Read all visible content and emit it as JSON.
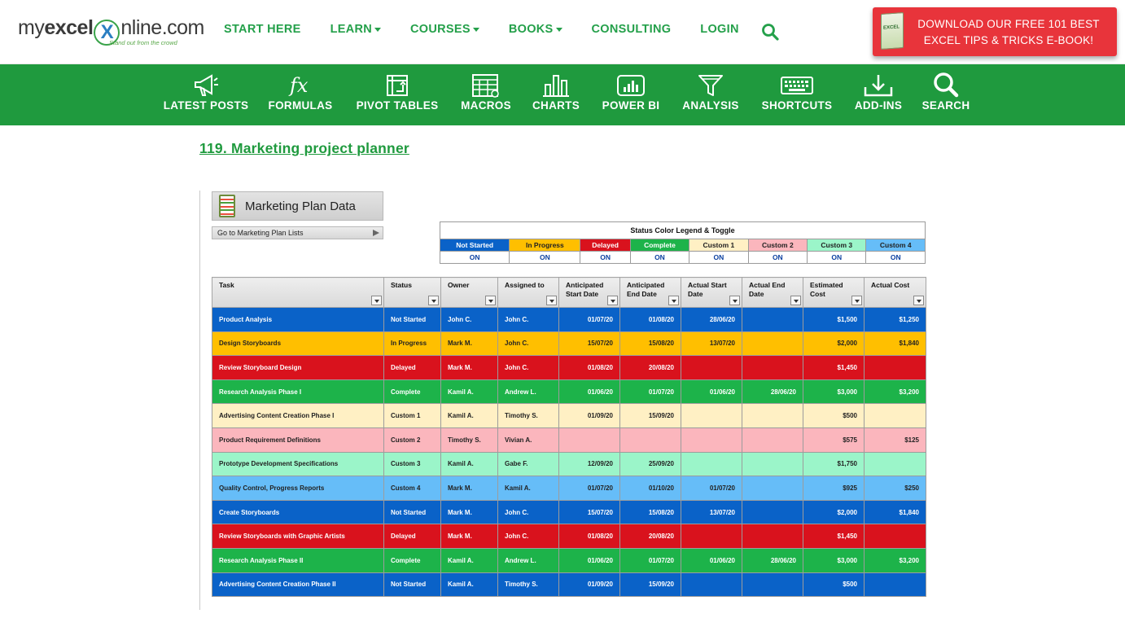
{
  "logo": {
    "text_my": "my",
    "text_excel": "excel",
    "text_x": "X",
    "text_rest": "nline.com",
    "tagline": "Stand out from the crowd"
  },
  "topnav": [
    {
      "label": "START HERE",
      "dropdown": false
    },
    {
      "label": "LEARN",
      "dropdown": true
    },
    {
      "label": "COURSES",
      "dropdown": true
    },
    {
      "label": "BOOKS",
      "dropdown": true
    },
    {
      "label": "CONSULTING",
      "dropdown": false
    },
    {
      "label": "LOGIN",
      "dropdown": false
    }
  ],
  "cta": {
    "line1": "DOWNLOAD OUR FREE 101 BEST",
    "line2": "EXCEL TIPS & TRICKS E-BOOK!",
    "book_label": "EXCEL"
  },
  "categories": [
    {
      "label": "LATEST POSTS",
      "icon": "megaphone-icon"
    },
    {
      "label": "FORMULAS",
      "icon": "function-icon"
    },
    {
      "label": "PIVOT TABLES",
      "icon": "pivot-table-icon"
    },
    {
      "label": "MACROS",
      "icon": "macro-sheet-icon"
    },
    {
      "label": "CHARTS",
      "icon": "bar-chart-icon"
    },
    {
      "label": "POWER BI",
      "icon": "power-bi-icon"
    },
    {
      "label": "ANALYSIS",
      "icon": "filter-funnel-icon"
    },
    {
      "label": "SHORTCUTS",
      "icon": "keyboard-icon"
    },
    {
      "label": "ADD-INS",
      "icon": "download-icon"
    },
    {
      "label": "SEARCH",
      "icon": "search-icon"
    }
  ],
  "article": {
    "heading": "119. Marketing project planner"
  },
  "sheet": {
    "title": "Marketing Plan Data",
    "goto": "Go to Marketing Plan Lists",
    "legend_title": "Status Color Legend & Toggle",
    "legend": [
      {
        "name": "Not Started",
        "toggle": "ON",
        "bg": "#0a62c8",
        "fg": "#ffffff"
      },
      {
        "name": "In Progress",
        "toggle": "ON",
        "bg": "#ffbf00",
        "fg": "#222222"
      },
      {
        "name": "Delayed",
        "toggle": "ON",
        "bg": "#d9121d",
        "fg": "#ffffff"
      },
      {
        "name": "Complete",
        "toggle": "ON",
        "bg": "#1db34a",
        "fg": "#ffffff"
      },
      {
        "name": "Custom 1",
        "toggle": "ON",
        "bg": "#fff0c4",
        "fg": "#222222"
      },
      {
        "name": "Custom 2",
        "toggle": "ON",
        "bg": "#fbb6bd",
        "fg": "#222222"
      },
      {
        "name": "Custom 3",
        "toggle": "ON",
        "bg": "#9bf5c9",
        "fg": "#222222"
      },
      {
        "name": "Custom 4",
        "toggle": "ON",
        "bg": "#66bdf8",
        "fg": "#222222"
      }
    ],
    "columns": [
      "Task",
      "Status",
      "Owner",
      "Assigned to",
      "Anticipated Start Date",
      "Anticipated End Date",
      "Actual Start Date",
      "Actual End Date",
      "Estimated Cost",
      "Actual Cost"
    ],
    "rows": [
      [
        "Product Analysis",
        "Not Started",
        "John C.",
        "John C.",
        "01/07/20",
        "01/08/20",
        "28/06/20",
        "",
        "$1,500",
        "$1,250"
      ],
      [
        "Design Storyboards",
        "In Progress",
        "Mark M.",
        "John C.",
        "15/07/20",
        "15/08/20",
        "13/07/20",
        "",
        "$2,000",
        "$1,840"
      ],
      [
        "Review Storyboard Design",
        "Delayed",
        "Mark M.",
        "John C.",
        "01/08/20",
        "20/08/20",
        "",
        "",
        "$1,450",
        ""
      ],
      [
        "Research Analysis Phase I",
        "Complete",
        "Kamil A.",
        "Andrew L.",
        "01/06/20",
        "01/07/20",
        "01/06/20",
        "28/06/20",
        "$3,000",
        "$3,200"
      ],
      [
        "Advertising Content Creation Phase I",
        "Custom 1",
        "Kamil A.",
        "Timothy S.",
        "01/09/20",
        "15/09/20",
        "",
        "",
        "$500",
        ""
      ],
      [
        "Product Requirement Definitions",
        "Custom 2",
        "Timothy S.",
        "Vivian A.",
        "",
        "",
        "",
        "",
        "$575",
        "$125"
      ],
      [
        "Prototype Development Specifications",
        "Custom 3",
        "Kamil A.",
        "Gabe F.",
        "12/09/20",
        "25/09/20",
        "",
        "",
        "$1,750",
        ""
      ],
      [
        "Quality Control, Progress Reports",
        "Custom 4",
        "Mark M.",
        "Kamil A.",
        "01/07/20",
        "01/10/20",
        "01/07/20",
        "",
        "$925",
        "$250"
      ],
      [
        "Create Storyboards",
        "Not Started",
        "Mark M.",
        "John C.",
        "15/07/20",
        "15/08/20",
        "13/07/20",
        "",
        "$2,000",
        "$1,840"
      ],
      [
        "Review Storyboards with Graphic Artists",
        "Delayed",
        "Mark M.",
        "John C.",
        "01/08/20",
        "20/08/20",
        "",
        "",
        "$1,450",
        ""
      ],
      [
        "Research Analysis Phase II",
        "Complete",
        "Kamil A.",
        "Andrew L.",
        "01/06/20",
        "01/07/20",
        "01/06/20",
        "28/06/20",
        "$3,000",
        "$3,200"
      ],
      [
        "Advertising Content Creation Phase II",
        "Not Started",
        "Kamil A.",
        "Timothy S.",
        "01/09/20",
        "15/09/20",
        "",
        "",
        "$500",
        ""
      ]
    ]
  },
  "colors": {
    "brand_green": "#1f9a3e",
    "cta_red": "#e8343b"
  }
}
